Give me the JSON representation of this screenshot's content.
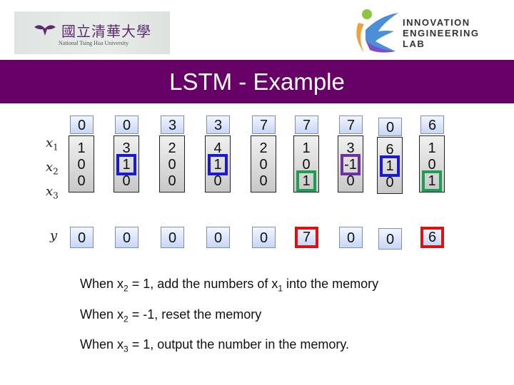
{
  "header": {
    "left_logo": {
      "chinese": "國立清華大學",
      "english": "National Tsing Hua University"
    },
    "right_logo": {
      "lines": [
        "INNOVATION",
        "ENGINEERING",
        "LAB"
      ]
    },
    "title": "LSTM - Example",
    "band_color": "#660066"
  },
  "labels": {
    "x1": "x",
    "x1_sub": "1",
    "x2": "x",
    "x2_sub": "2",
    "x3": "x",
    "x3_sub": "3",
    "y": "y"
  },
  "columns": [
    {
      "memory": "0",
      "x": [
        "1",
        "0",
        "0"
      ],
      "y": "0"
    },
    {
      "memory": "0",
      "x": [
        "3",
        "1",
        "0"
      ],
      "y": "0",
      "highlight": {
        "row": 1,
        "color": "#1a1ad0"
      }
    },
    {
      "memory": "3",
      "x": [
        "2",
        "0",
        "0"
      ],
      "y": "0"
    },
    {
      "memory": "3",
      "x": [
        "4",
        "1",
        "0"
      ],
      "y": "0",
      "highlight": {
        "row": 1,
        "color": "#1a1ad0"
      }
    },
    {
      "memory": "7",
      "x": [
        "2",
        "0",
        "0"
      ],
      "y": "0"
    },
    {
      "memory": "7",
      "x": [
        "1",
        "0",
        "1"
      ],
      "y": "7",
      "highlight": {
        "row": 2,
        "color": "#1aa050"
      },
      "y_highlight": "#e01010"
    },
    {
      "memory": "7",
      "x": [
        "3",
        "-1",
        "0"
      ],
      "y": "0",
      "highlight": {
        "row": 1,
        "color": "#7030a0"
      }
    },
    {
      "memory": "0",
      "x": [
        "6",
        "1",
        "0"
      ],
      "y": "0",
      "highlight": {
        "row": 1,
        "color": "#1a1ad0"
      }
    },
    {
      "memory": "6",
      "x": [
        "1",
        "0",
        "1"
      ],
      "y": "6",
      "highlight": {
        "row": 2,
        "color": "#1aa050"
      },
      "y_highlight": "#e01010"
    }
  ],
  "notes": [
    {
      "pre": "When x",
      "sub": "2",
      "post": " = 1, add the numbers of x",
      "sub2": "1",
      "post2": " into the memory"
    },
    {
      "pre": "When x",
      "sub": "2",
      "post": " = -1, reset the memory"
    },
    {
      "pre": "When x",
      "sub": "3",
      "post": " = 1, output the number in the memory."
    }
  ]
}
